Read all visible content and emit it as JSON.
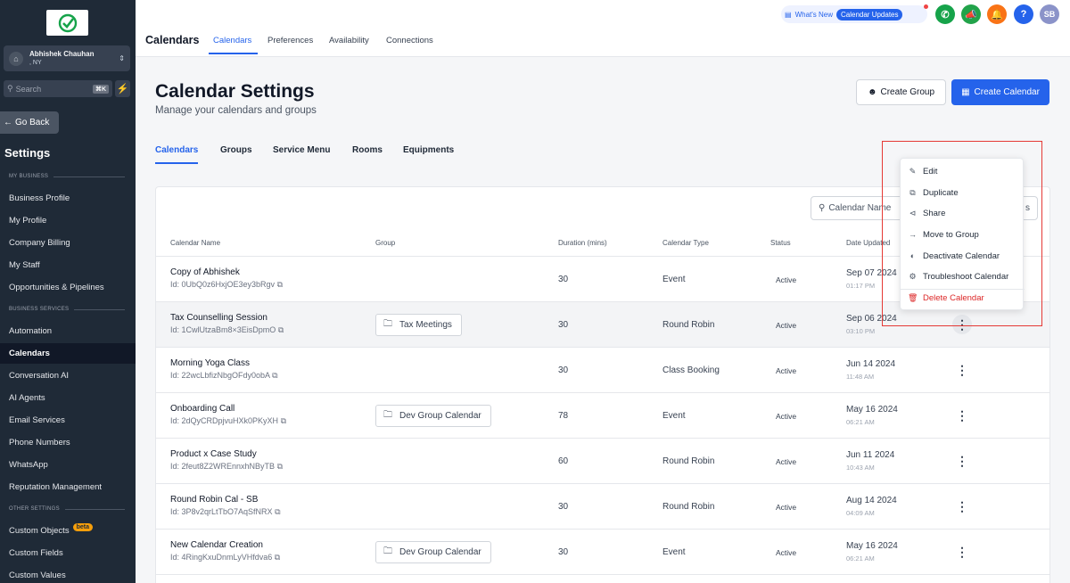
{
  "sidebar": {
    "account_name": "Abhishek Chauhan",
    "account_location": ", NY",
    "search_placeholder": "Search",
    "search_shortcut": "⌘K",
    "go_back": "Go Back",
    "title": "Settings",
    "section_my_business": "MY BUSINESS",
    "section_business_services": "BUSINESS SERVICES",
    "section_other_settings": "OTHER SETTINGS",
    "items": [
      {
        "label": "Business Profile"
      },
      {
        "label": "My Profile"
      },
      {
        "label": "Company Billing"
      },
      {
        "label": "My Staff"
      },
      {
        "label": "Opportunities & Pipelines"
      },
      {
        "label": "Automation"
      },
      {
        "label": "Calendars",
        "active": true
      },
      {
        "label": "Conversation AI"
      },
      {
        "label": "AI Agents"
      },
      {
        "label": "Email Services"
      },
      {
        "label": "Phone Numbers"
      },
      {
        "label": "WhatsApp"
      },
      {
        "label": "Reputation Management"
      },
      {
        "label": "Custom Objects",
        "badge": "beta"
      },
      {
        "label": "Custom Fields"
      },
      {
        "label": "Custom Values"
      }
    ]
  },
  "topbar": {
    "title": "Calendars",
    "tabs": [
      "Calendars",
      "Preferences",
      "Availability",
      "Connections"
    ],
    "whats_new": "What's New",
    "calendar_updates": "Calendar Updates",
    "avatar_initials": "SB",
    "help": "?"
  },
  "main": {
    "title": "Calendar Settings",
    "subtitle": "Manage your calendars and groups",
    "create_group": "Create Group",
    "create_calendar": "Create Calendar",
    "tabs": [
      "Calendars",
      "Groups",
      "Service Menu",
      "Rooms",
      "Equipments"
    ],
    "search_placeholder": "Calendar Name",
    "search_tail": "s",
    "columns": [
      "Calendar Name",
      "Group",
      "Duration (mins)",
      "Calendar Type",
      "Status",
      "Date Updated"
    ],
    "rows": [
      {
        "name": "Copy of Abhishek",
        "id": "Id: 0UbQ0z6HxjOE3ey3bRgv",
        "group": "",
        "duration": "30",
        "type": "Event",
        "status": "Active",
        "date": "Sep 07 2024",
        "time": "01:17 PM"
      },
      {
        "name": "Tax Counselling Session",
        "id": "Id: 1CwlUtzaBm8×3EisDpmO",
        "group": "Tax Meetings",
        "duration": "30",
        "type": "Round Robin",
        "status": "Active",
        "date": "Sep 06 2024",
        "time": "03:10 PM"
      },
      {
        "name": "Morning Yoga Class",
        "id": "Id: 22wcLbfizNbgOFdy0obA",
        "group": "",
        "duration": "30",
        "type": "Class Booking",
        "status": "Active",
        "date": "Jun 14 2024",
        "time": "11:48 AM"
      },
      {
        "name": "Onboarding Call",
        "id": "Id: 2dQyCRDpjvuHXk0PKyXH",
        "group": "Dev Group Calendar",
        "duration": "78",
        "type": "Event",
        "status": "Active",
        "date": "May 16 2024",
        "time": "06:21 AM"
      },
      {
        "name": "Product x Case Study",
        "id": "Id: 2feut8Z2WREnnxhNByTB",
        "group": "",
        "duration": "60",
        "type": "Round Robin",
        "status": "Active",
        "date": "Jun 11 2024",
        "time": "10:43 AM"
      },
      {
        "name": "Round Robin Cal - SB",
        "id": "Id: 3P8v2qrLtTbO7AqSfNRX",
        "group": "",
        "duration": "30",
        "type": "Round Robin",
        "status": "Active",
        "date": "Aug 14 2024",
        "time": "04:09 AM"
      },
      {
        "name": "New Calendar Creation",
        "id": "Id: 4RingKxuDnmLyVHfdva6",
        "group": "Dev Group Calendar",
        "duration": "30",
        "type": "Event",
        "status": "Active",
        "date": "May 16 2024",
        "time": "06:21 AM"
      }
    ]
  },
  "dropdown": {
    "items": [
      {
        "label": "Edit",
        "icon": "pencil-icon"
      },
      {
        "label": "Duplicate",
        "icon": "copy-icon"
      },
      {
        "label": "Share",
        "icon": "share-icon"
      },
      {
        "label": "Move to Group",
        "icon": "arrow-right-icon"
      },
      {
        "label": "Deactivate Calendar",
        "icon": "toggle-icon"
      },
      {
        "label": "Troubleshoot Calendar",
        "icon": "gear-icon"
      },
      {
        "label": "Delete Calendar",
        "icon": "trash-icon"
      }
    ]
  },
  "colors": {
    "primary": "#2563eb",
    "sidebar_bg": "#1f2a37",
    "danger": "#dc2626",
    "highlight_frame": "#e53935",
    "phone_btn": "#16a34a",
    "megaphone_btn": "#22a34a",
    "bell_btn": "#f97316",
    "help_btn": "#2563eb",
    "avatar_bg": "#8b93c9"
  }
}
